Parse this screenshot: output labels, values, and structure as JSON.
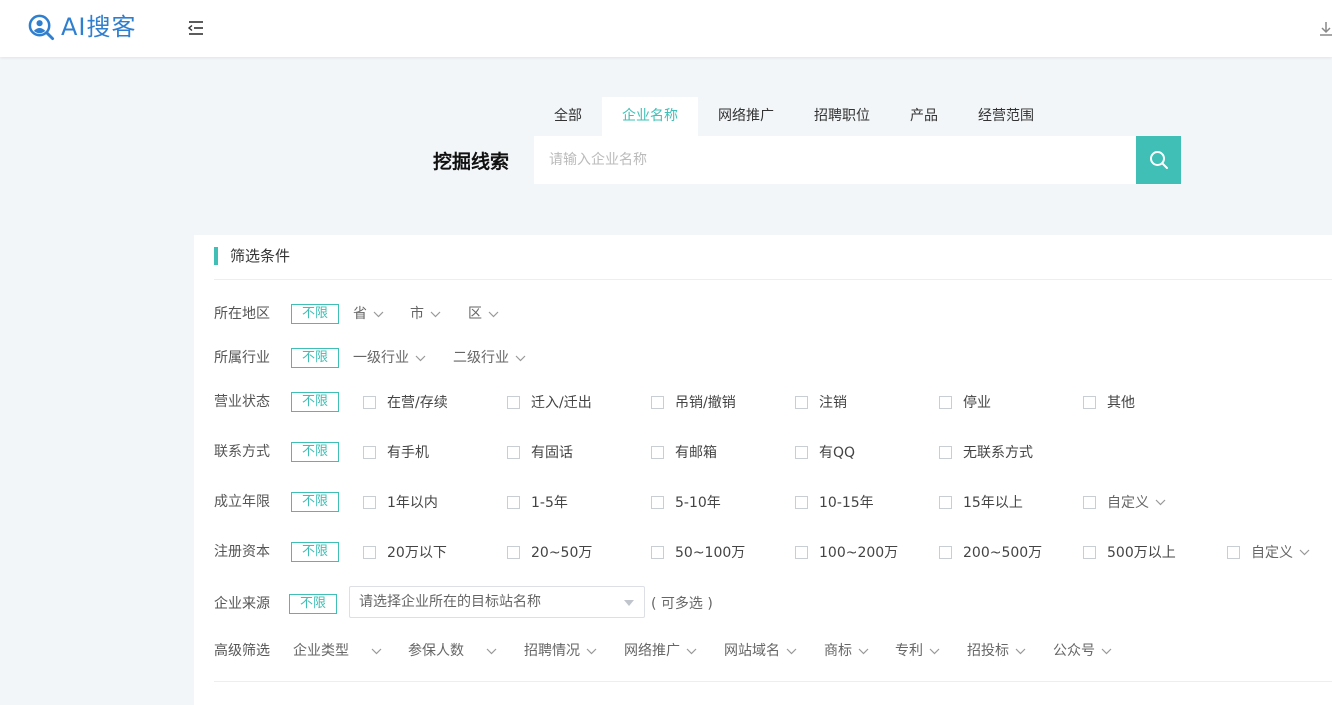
{
  "header": {
    "logo_text": "AI搜客",
    "accent": "#3fbfb6",
    "logo_color": "#2f7fd0"
  },
  "search": {
    "tabs": [
      "全部",
      "企业名称",
      "网络推广",
      "招聘职位",
      "产品",
      "经营范围"
    ],
    "active_tab": "企业名称",
    "label": "挖掘线索",
    "placeholder": "请输入企业名称"
  },
  "filters": {
    "title": "筛选条件",
    "unlimited": "不限",
    "region": {
      "label": "所在地区",
      "province": "省",
      "city": "市",
      "district": "区"
    },
    "industry": {
      "label": "所属行业",
      "level1": "一级行业",
      "level2": "二级行业"
    },
    "status": {
      "label": "营业状态",
      "options": [
        "在营/存续",
        "迁入/迁出",
        "吊销/撤销",
        "注销",
        "停业",
        "其他"
      ]
    },
    "contact": {
      "label": "联系方式",
      "options": [
        "有手机",
        "有固话",
        "有邮箱",
        "有QQ",
        "无联系方式"
      ]
    },
    "years": {
      "label": "成立年限",
      "options": [
        "1年以内",
        "1-5年",
        "5-10年",
        "10-15年",
        "15年以上"
      ],
      "custom": "自定义"
    },
    "capital": {
      "label": "注册资本",
      "options": [
        "20万以下",
        "20~50万",
        "50~100万",
        "100~200万",
        "200~500万",
        "500万以上"
      ],
      "custom": "自定义"
    },
    "source": {
      "label": "企业来源",
      "placeholder": "请选择企业所在的目标站名称",
      "hint": "( 可多选 )"
    },
    "advanced": {
      "label": "高级筛选",
      "items": [
        "企业类型",
        "参保人数",
        "招聘情况",
        "网络推广",
        "网站域名",
        "商标",
        "专利",
        "招投标",
        "公众号"
      ]
    }
  }
}
